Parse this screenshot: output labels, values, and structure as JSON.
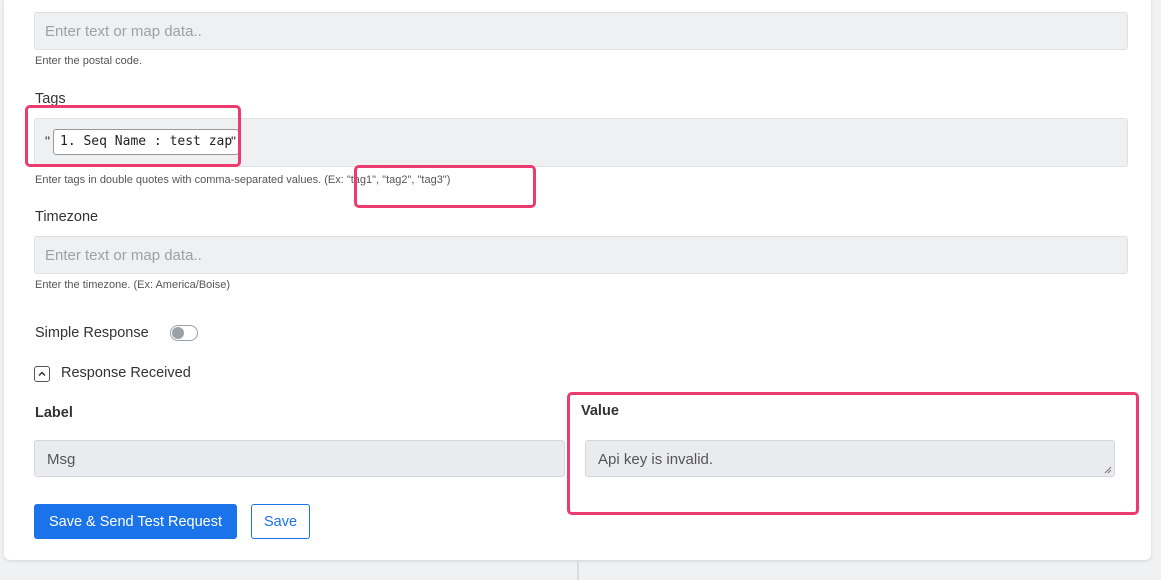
{
  "postal": {
    "placeholder": "Enter text or map data..",
    "help": "Enter the postal code."
  },
  "tags": {
    "label": "Tags",
    "open_quote": "\"",
    "close_quote": "\"",
    "pill_value": "1. Seq Name : test zap",
    "help": "Enter tags in double quotes with comma-separated values. (Ex: \"tag1\", \"tag2\", \"tag3\")"
  },
  "timezone": {
    "label": "Timezone",
    "placeholder": "Enter text or map data..",
    "help": "Enter the timezone. (Ex: America/Boise)"
  },
  "simple_response": {
    "label": "Simple Response",
    "enabled": false
  },
  "response_received": {
    "label": "Response Received",
    "expanded": true
  },
  "response_table": {
    "label_header": "Label",
    "value_header": "Value",
    "rows": [
      {
        "label": "Msg",
        "value": "Api key is invalid."
      }
    ]
  },
  "buttons": {
    "save_send": "Save & Send Test Request",
    "save": "Save"
  },
  "colors": {
    "primary": "#1a73e8",
    "highlight": "#ec3b6e"
  }
}
